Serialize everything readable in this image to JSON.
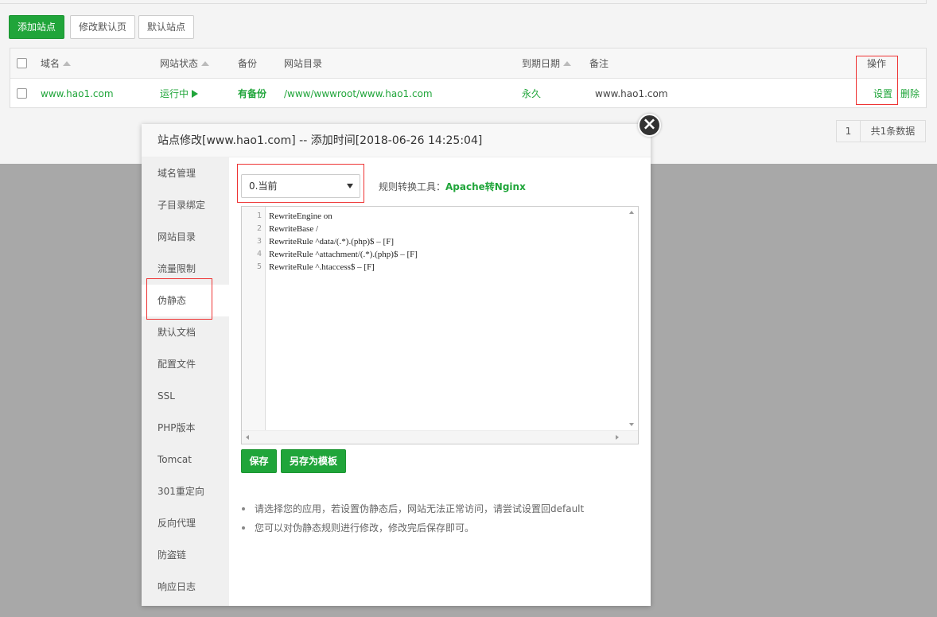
{
  "toolbar": {
    "add_site": "添加站点",
    "edit_default_page": "修改默认页",
    "default_site": "默认站点"
  },
  "table": {
    "headers": {
      "domain": "域名",
      "status": "网站状态",
      "backup": "备份",
      "dir": "网站目录",
      "expire": "到期日期",
      "remark": "备注",
      "actions": "操作"
    },
    "rows": [
      {
        "domain": "www.hao1.com",
        "status": "运行中",
        "backup": "有备份",
        "dir": "/www/wwwroot/www.hao1.com",
        "expire": "永久",
        "remark": "www.hao1.com",
        "settings": "设置",
        "delete": "删除"
      }
    ]
  },
  "pager": {
    "page": "1",
    "total": "共1条数据"
  },
  "modal": {
    "title": "站点修改[www.hao1.com] -- 添加时间[2018-06-26 14:25:04]",
    "close_icon": "close-icon",
    "sidebar": [
      {
        "label": "域名管理"
      },
      {
        "label": "子目录绑定"
      },
      {
        "label": "网站目录"
      },
      {
        "label": "流量限制"
      },
      {
        "label": "伪静态"
      },
      {
        "label": "默认文档"
      },
      {
        "label": "配置文件"
      },
      {
        "label": "SSL"
      },
      {
        "label": "PHP版本"
      },
      {
        "label": "Tomcat"
      },
      {
        "label": "301重定向"
      },
      {
        "label": "反向代理"
      },
      {
        "label": "防盗链"
      },
      {
        "label": "响应日志"
      }
    ],
    "active_item": "伪静态",
    "template_select": "0.当前",
    "tool_label": "规则转换工具：",
    "tool_link": "Apache转Nginx",
    "editor_lines": [
      {
        "num": "1",
        "text": "RewriteEngine on"
      },
      {
        "num": "2",
        "text": "RewriteBase /"
      },
      {
        "num": "3",
        "text": "RewriteRule ^data/(.*).(php)$ – [F]"
      },
      {
        "num": "4",
        "text": "RewriteRule ^attachment/(.*).(php)$ – [F]"
      },
      {
        "num": "5",
        "text": "RewriteRule ^.htaccess$ – [F]"
      }
    ],
    "save_label": "保存",
    "save_template_label": "另存为模板",
    "tips": [
      "请选择您的应用，若设置伪静态后，网站无法正常访问，请尝试设置回default",
      "您可以对伪静态规则进行修改，修改完后保存即可。"
    ]
  },
  "colors": {
    "accent": "#20a53a",
    "highlight": "#e33333"
  }
}
